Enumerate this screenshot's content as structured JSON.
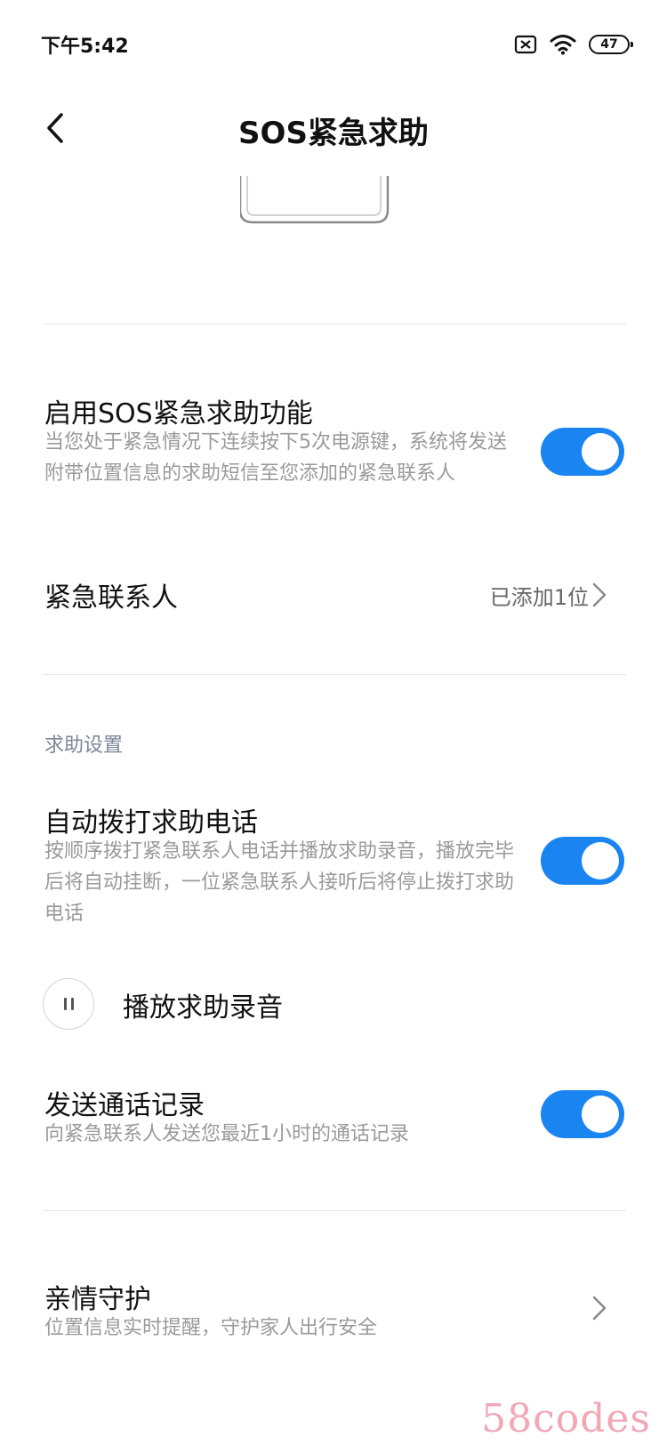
{
  "status_bar": {
    "time": "下午5:42",
    "battery": "47",
    "icons": [
      "sim-blocked-icon",
      "wifi-icon",
      "battery-icon"
    ]
  },
  "header": {
    "title": "SOS紧急求助",
    "back_icon": "chevron-left-icon"
  },
  "sos_toggle": {
    "title": "启用SOS紧急求助功能",
    "desc": "当您处于紧急情况下连续按下5次电源键，系统将发送附带位置信息的求助短信至您添加的紧急联系人",
    "enabled": true
  },
  "contacts": {
    "title": "紧急联系人",
    "value": "已添加1位"
  },
  "help_settings": {
    "section_title": "求助设置",
    "auto_call": {
      "title": "自动拨打求助电话",
      "desc": "按顺序拨打紧急联系人电话并播放求助录音，播放完毕后将自动挂断，一位紧急联系人接听后将停止拨打求助电话",
      "enabled": true
    },
    "play_recording": {
      "label": "播放求助录音",
      "icon": "pause-icon"
    },
    "send_call_log": {
      "title": "发送通话记录",
      "desc": "向紧急联系人发送您最近1小时的通话记录",
      "enabled": true
    }
  },
  "family_guard": {
    "title": "亲情守护",
    "desc": "位置信息实时提醒，守护家人出行安全"
  },
  "watermark": "58codes",
  "colors": {
    "accent": "#1a85f0",
    "section_header": "#7d8596",
    "secondary_text": "#9a9a9a",
    "watermark": "#f2a7b5"
  }
}
